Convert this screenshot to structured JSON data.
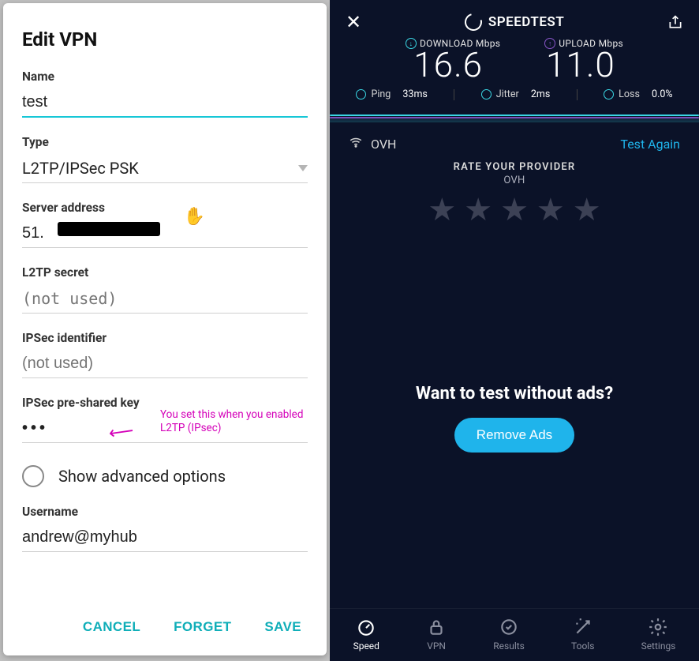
{
  "vpn": {
    "dialog_title": "Edit VPN",
    "name_label": "Name",
    "name_value": "test",
    "type_label": "Type",
    "type_value": "L2TP/IPSec PSK",
    "server_label": "Server address",
    "server_value": "51.",
    "l2tp_label": "L2TP secret",
    "l2tp_placeholder": "(not used)",
    "ipsec_id_label": "IPSec identifier",
    "ipsec_id_placeholder": "(not used)",
    "psk_label": "IPSec pre-shared key",
    "psk_value": "•••",
    "psk_annotation": "You set this when you enabled L2TP (IPsec)",
    "adv_label": "Show advanced options",
    "username_label": "Username",
    "username_value": "andrew@myhub",
    "btn_cancel": "CANCEL",
    "btn_forget": "FORGET",
    "btn_save": "SAVE"
  },
  "st": {
    "title": "SPEEDTEST",
    "download_label": "DOWNLOAD Mbps",
    "upload_label": "UPLOAD Mbps",
    "download_value": "16.6",
    "upload_value": "11.0",
    "ping_label": "Ping",
    "ping_value": "33ms",
    "jitter_label": "Jitter",
    "jitter_value": "2ms",
    "loss_label": "Loss",
    "loss_value": "0.0%",
    "provider": "OVH",
    "test_again": "Test Again",
    "rate_heading": "RATE YOUR PROVIDER",
    "rate_provider": "OVH",
    "noads_heading": "Want to test without ads?",
    "remove_ads": "Remove Ads",
    "tabs": {
      "speed": "Speed",
      "vpn": "VPN",
      "results": "Results",
      "tools": "Tools",
      "settings": "Settings"
    },
    "colors": {
      "download": "#3ad7e4",
      "upload": "#8956c9",
      "accent": "#1fb4eb"
    }
  }
}
